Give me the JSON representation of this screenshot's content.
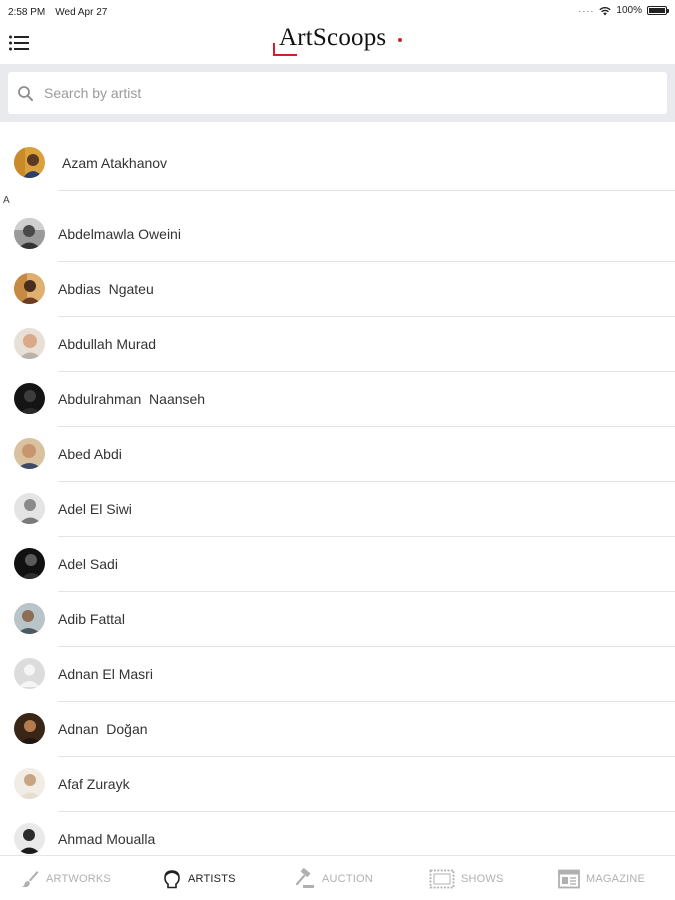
{
  "status_bar": {
    "time": "2:58 PM",
    "date": "Wed Apr 27",
    "battery": "100%"
  },
  "header": {
    "logo_text": "ArtScoops"
  },
  "search": {
    "placeholder": "Search by artist"
  },
  "section_letter": "A",
  "artists": [
    {
      "name": "Azam Atakhanov"
    },
    {
      "name": "Abdelmawla Oweini"
    },
    {
      "name": "Abdias  Ngateu"
    },
    {
      "name": "Abdullah Murad"
    },
    {
      "name": "Abdulrahman  Naanseh"
    },
    {
      "name": "Abed Abdi"
    },
    {
      "name": "Adel El Siwi"
    },
    {
      "name": "Adel Sadi"
    },
    {
      "name": "Adib Fattal"
    },
    {
      "name": "Adnan El Masri"
    },
    {
      "name": "Adnan  Doğan"
    },
    {
      "name": "Afaf Zurayk"
    },
    {
      "name": "Ahmad Moualla"
    }
  ],
  "tabs": [
    {
      "label": "ARTWORKS",
      "icon": "brush-icon"
    },
    {
      "label": "ARTISTS",
      "icon": "artist-head-icon"
    },
    {
      "label": "AUCTION",
      "icon": "gavel-icon"
    },
    {
      "label": "SHOWS",
      "icon": "frame-icon"
    },
    {
      "label": "MAGAZINE",
      "icon": "magazine-icon"
    }
  ],
  "colors": {
    "brand_accent": "#d0202a",
    "tab_inactive": "#b0b0b0",
    "tab_active": "#222222",
    "search_background": "#e9eaee"
  }
}
